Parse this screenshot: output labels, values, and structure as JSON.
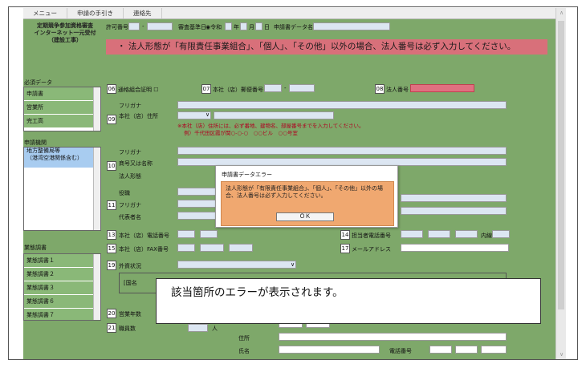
{
  "menu": {
    "tabs": [
      "メニュー",
      "申請の手引き",
      "連絡先"
    ]
  },
  "title": {
    "line1": "定期競争参加資格審査",
    "line2": "インターネット一元受付",
    "line3": "（建設工事）"
  },
  "header": {
    "permit_label": "許可番号",
    "review_date_label": "審査基準日",
    "era": "令和",
    "year_unit": "年",
    "month_unit": "月",
    "day_unit": "日",
    "app_data_label": "申請書データ名"
  },
  "warning": "・ 法人形態が「有限責任事業組合」、「個人」、「その他」以外の場合、法人番号は必ず入力してください。",
  "sidebar": {
    "required_label": "必須データ",
    "required_items": [
      "申請書",
      "営業所",
      "完工高"
    ],
    "agency_label": "申請機関",
    "agency_item": "地方整備局等\n（港湾空港関係含む）",
    "industry_label": "業態調書",
    "industry_items": [
      "業態調書１",
      "業態調書２",
      "業態調書３",
      "業態調書６",
      "業態調書７"
    ]
  },
  "fields": {
    "n06": "06",
    "tsuka_label": "通格組合証明",
    "n07": "07",
    "postal_label": "本社（店）郵便番号",
    "n08": "08",
    "corp_number_label": "法人番号",
    "furigana": "フリガナ",
    "n09": "09",
    "address_label": "本社（店）住所",
    "address_note1": "※本社（店）住所には、必ず番地、建物名、部屋番号までを入力してください。",
    "address_note2": "例）千代田区霞が関○-○-○　○○ビル　○○号室",
    "n10": "10",
    "trade_name_label": "商号又は名称",
    "corp_form_label": "法人形態",
    "position_label": "役職",
    "n11": "11",
    "rep_name_label": "代表者名",
    "n13": "13",
    "phone_label": "本社（店）電話番号",
    "n14": "14",
    "contact_phone_label": "担当者電話番号",
    "ext_label": "内線",
    "n15": "15",
    "fax_label": "本社（店）FAX番号",
    "n17": "17",
    "email_label": "メールアドレス",
    "n19": "19",
    "foreign_label": "外資状況",
    "country_label": "[国名",
    "n20": "20",
    "years_label": "営業年数",
    "n21": "21",
    "employees_label": "職員数",
    "person_unit": "人",
    "jusho_label": "住所",
    "shimei_label": "氏名",
    "denwa_label": "電話番号"
  },
  "dialog": {
    "title": "申請書データエラー",
    "message": "法人形態が「有限責任事業組合」、「個人」、「その他」以外の場合、法人番号は必ず入力してください。",
    "ok": "ＯＫ"
  },
  "caption": "該当箇所のエラーが表示されます。"
}
